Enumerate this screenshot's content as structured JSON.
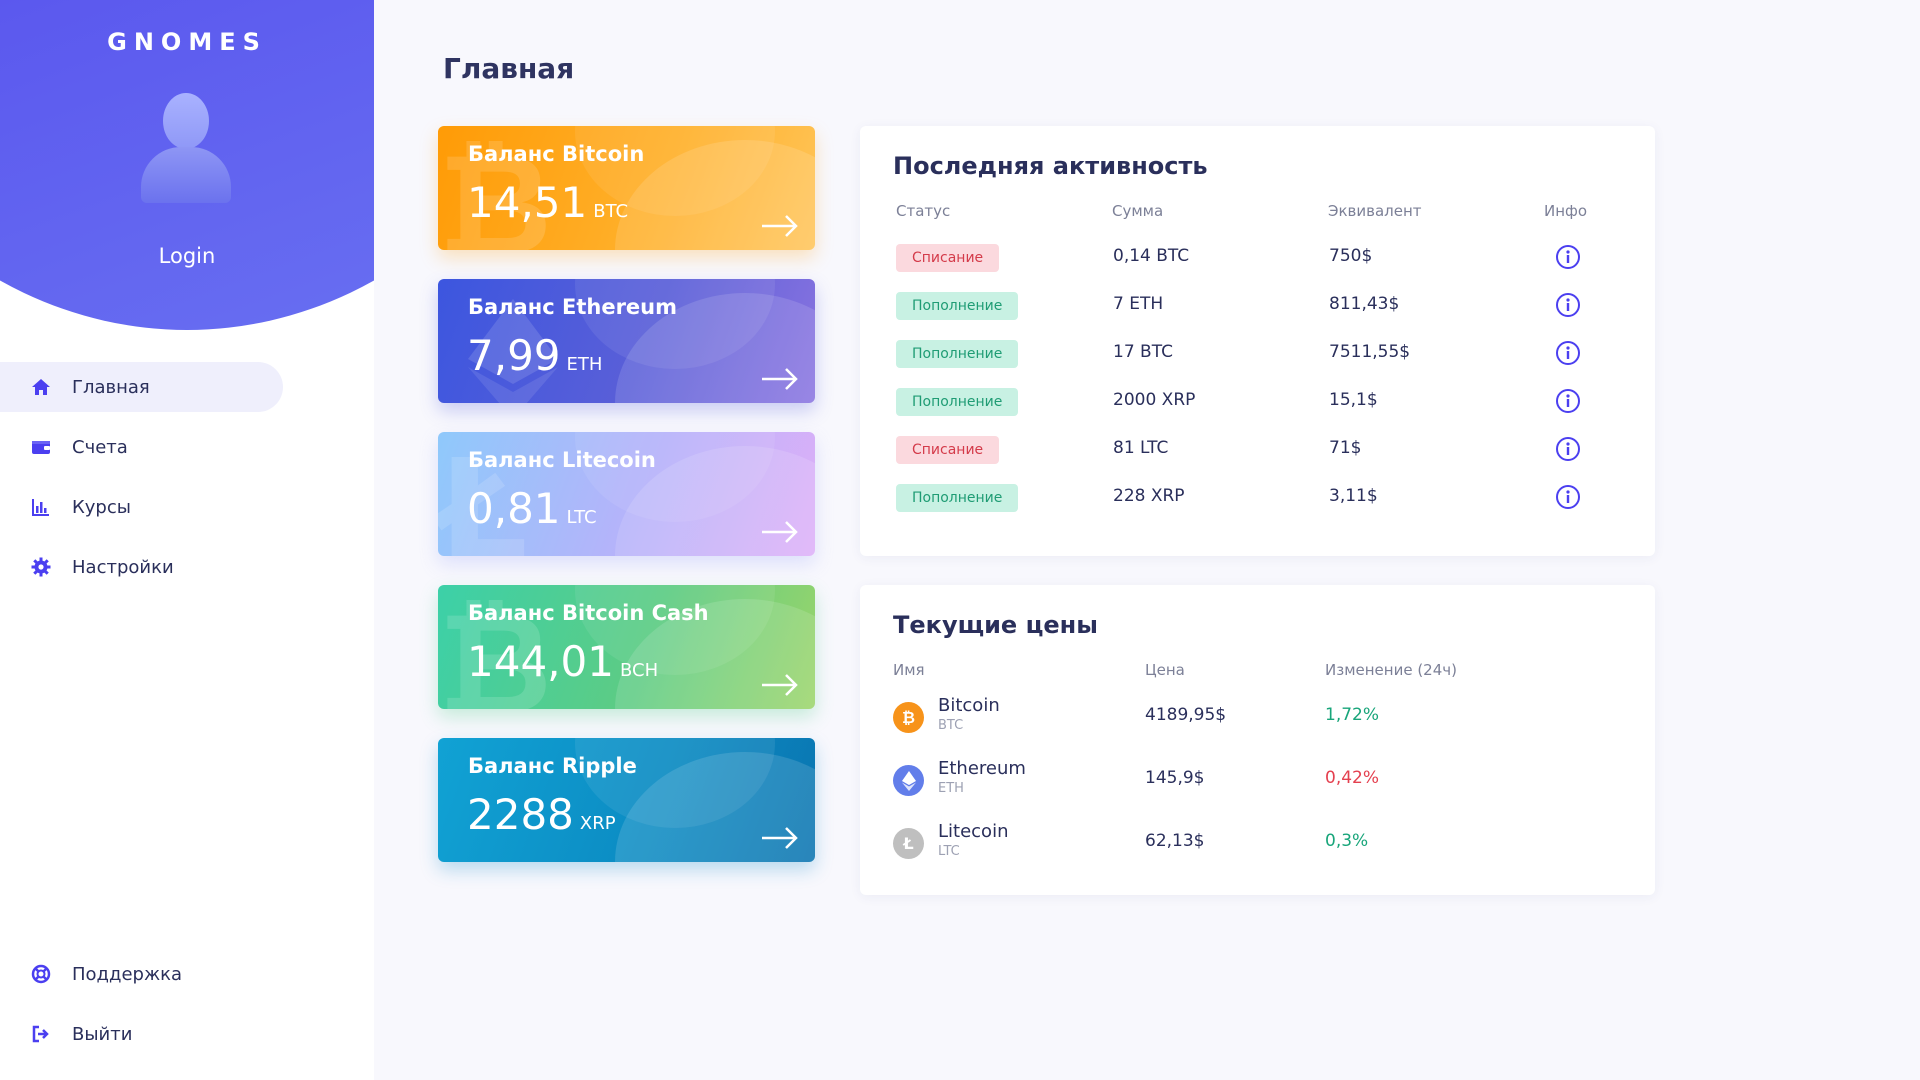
{
  "app": {
    "brand": "GNOMES",
    "user": "Login"
  },
  "nav": {
    "items": [
      {
        "label": "Главная",
        "icon": "home-icon"
      },
      {
        "label": "Счета",
        "icon": "wallet-icon"
      },
      {
        "label": "Курсы",
        "icon": "chart-icon"
      },
      {
        "label": "Настройки",
        "icon": "gear-icon"
      }
    ],
    "bottom": [
      {
        "label": "Поддержка",
        "icon": "lifebuoy-icon"
      },
      {
        "label": "Выйти",
        "icon": "logout-icon"
      }
    ]
  },
  "page": {
    "title": "Главная"
  },
  "balances": [
    {
      "title": "Баланс Bitcoin",
      "value": "14,51",
      "unit": "BTC"
    },
    {
      "title": "Баланс Ethereum",
      "value": "7,99",
      "unit": "ETH"
    },
    {
      "title": "Баланс Litecoin",
      "value": "0,81",
      "unit": "LTC"
    },
    {
      "title": "Баланс Bitcoin Cash",
      "value": "144,01",
      "unit": "BCH"
    },
    {
      "title": "Баланс Ripple",
      "value": "2288",
      "unit": "XRP"
    }
  ],
  "activity": {
    "title": "Последняя активность",
    "columns": [
      "Статус",
      "Сумма",
      "Эквивалент",
      "Инфо"
    ],
    "rows": [
      {
        "status": "Списание",
        "amount": "0,14 BTC",
        "equiv": "750$"
      },
      {
        "status": "Пополнение",
        "amount": "7 ETH",
        "equiv": "811,43$"
      },
      {
        "status": "Пополнение",
        "amount": "17 BTC",
        "equiv": "7511,55$"
      },
      {
        "status": "Пополнение",
        "amount": "2000 XRP",
        "equiv": "15,1$"
      },
      {
        "status": "Списание",
        "amount": "81 LTC",
        "equiv": "71$"
      },
      {
        "status": "Пополнение",
        "amount": "228 XRP",
        "equiv": "3,11$"
      }
    ]
  },
  "prices": {
    "title": "Текущие цены",
    "columns": [
      "Имя",
      "Цена",
      "Изменение (24ч)"
    ],
    "rows": [
      {
        "name": "Bitcoin",
        "code": "BTC",
        "price": "4189,95$",
        "change": "1,72%"
      },
      {
        "name": "Ethereum",
        "code": "ETH",
        "price": "145,9$",
        "change": "0,42%"
      },
      {
        "name": "Litecoin",
        "code": "LTC",
        "price": "62,13$",
        "change": "0,3%"
      }
    ]
  },
  "colors": {
    "accent": "#4b3ff0",
    "positive": "#18a57a",
    "negative": "#e4404f"
  }
}
